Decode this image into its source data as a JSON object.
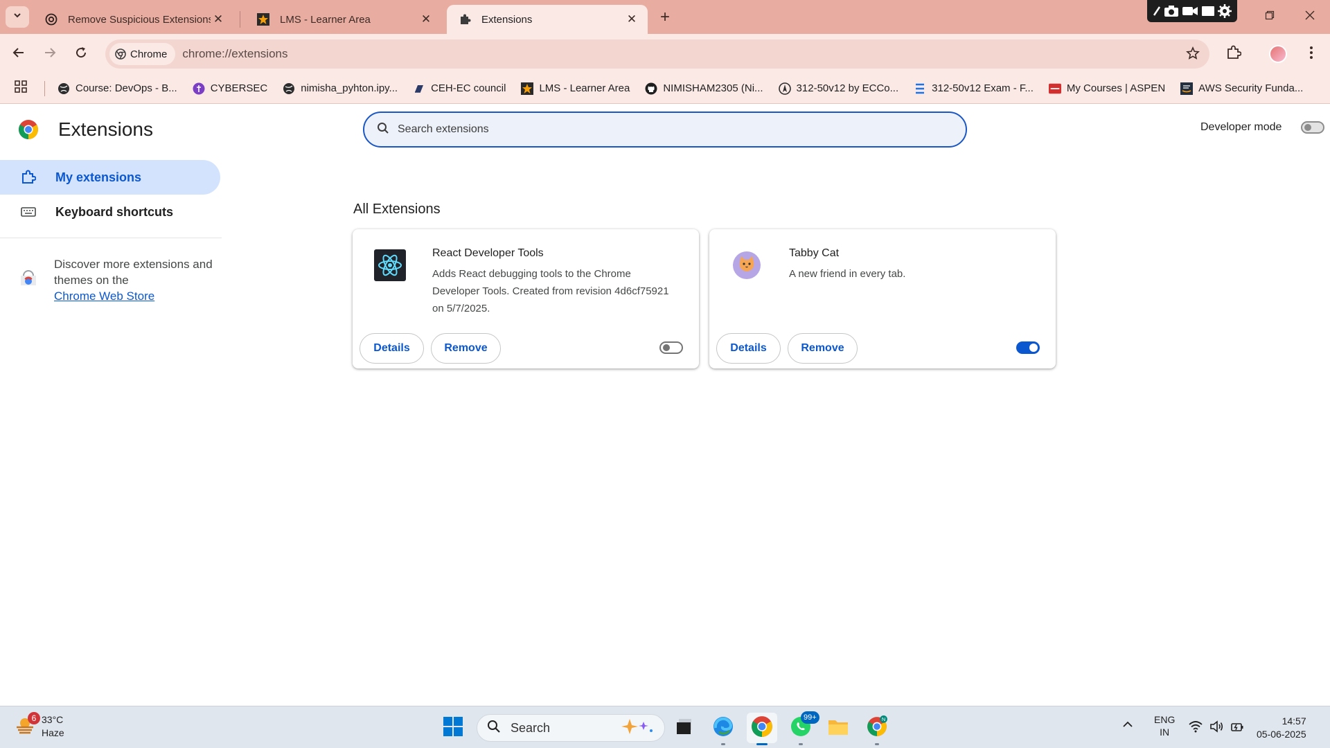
{
  "tabs": [
    {
      "title": "Remove Suspicious Extensions",
      "icon": "openai-icon"
    },
    {
      "title": "LMS - Learner Area",
      "icon": "star-icon"
    },
    {
      "title": "Extensions",
      "icon": "puzzle-icon",
      "active": true
    }
  ],
  "toolbar": {
    "chip_label": "Chrome",
    "url": "chrome://extensions"
  },
  "bookmarks": [
    {
      "label": "Course: DevOps - B...",
      "icon": "globe-icon"
    },
    {
      "label": "CYBERSEC",
      "icon": "cybersec-icon"
    },
    {
      "label": "nimisha_pyhton.ipy...",
      "icon": "globe-icon"
    },
    {
      "label": "CEH-EC council",
      "icon": "book-icon"
    },
    {
      "label": "LMS - Learner Area",
      "icon": "star-icon"
    },
    {
      "label": "NIMISHAM2305 (Ni...",
      "icon": "github-icon"
    },
    {
      "label": "312-50v12 by ECCo...",
      "icon": "compass-icon"
    },
    {
      "label": "312-50v12 Exam - F...",
      "icon": "list-icon"
    },
    {
      "label": "My Courses | ASPEN",
      "icon": "ecouncil-icon"
    },
    {
      "label": "AWS Security Funda...",
      "icon": "aws-icon"
    }
  ],
  "page": {
    "title": "Extensions",
    "search_placeholder": "Search extensions",
    "developer_mode_label": "Developer mode",
    "developer_mode": false,
    "nav": [
      {
        "label": "My extensions",
        "icon": "extensions-icon",
        "selected": true
      },
      {
        "label": "Keyboard shortcuts",
        "icon": "keyboard-icon",
        "selected": false
      }
    ],
    "discover_text": "Discover more extensions and themes on the",
    "discover_link": "Chrome Web Store",
    "section_title": "All Extensions",
    "extensions": [
      {
        "name": "React Developer Tools",
        "description": "Adds React debugging tools to the Chrome Developer Tools. Created from revision 4d6cf75921 on 5/7/2025.",
        "enabled": false,
        "details_label": "Details",
        "remove_label": "Remove",
        "icon": "react-icon"
      },
      {
        "name": "Tabby Cat",
        "description": "A new friend in every tab.",
        "enabled": true,
        "details_label": "Details",
        "remove_label": "Remove",
        "icon": "cat-icon"
      }
    ]
  },
  "taskbar": {
    "weather_temp": "33°C",
    "weather_desc": "Haze",
    "weather_badge": "6",
    "search_label": "Search",
    "whatsapp_badge": "99+",
    "lang_line1": "ENG",
    "lang_line2": "IN",
    "time": "14:57",
    "date": "05-06-2025"
  },
  "colors": {
    "accent": "#0b57d0",
    "tabstrip": "#e8ada0",
    "toolbar": "#fbe9e5"
  }
}
